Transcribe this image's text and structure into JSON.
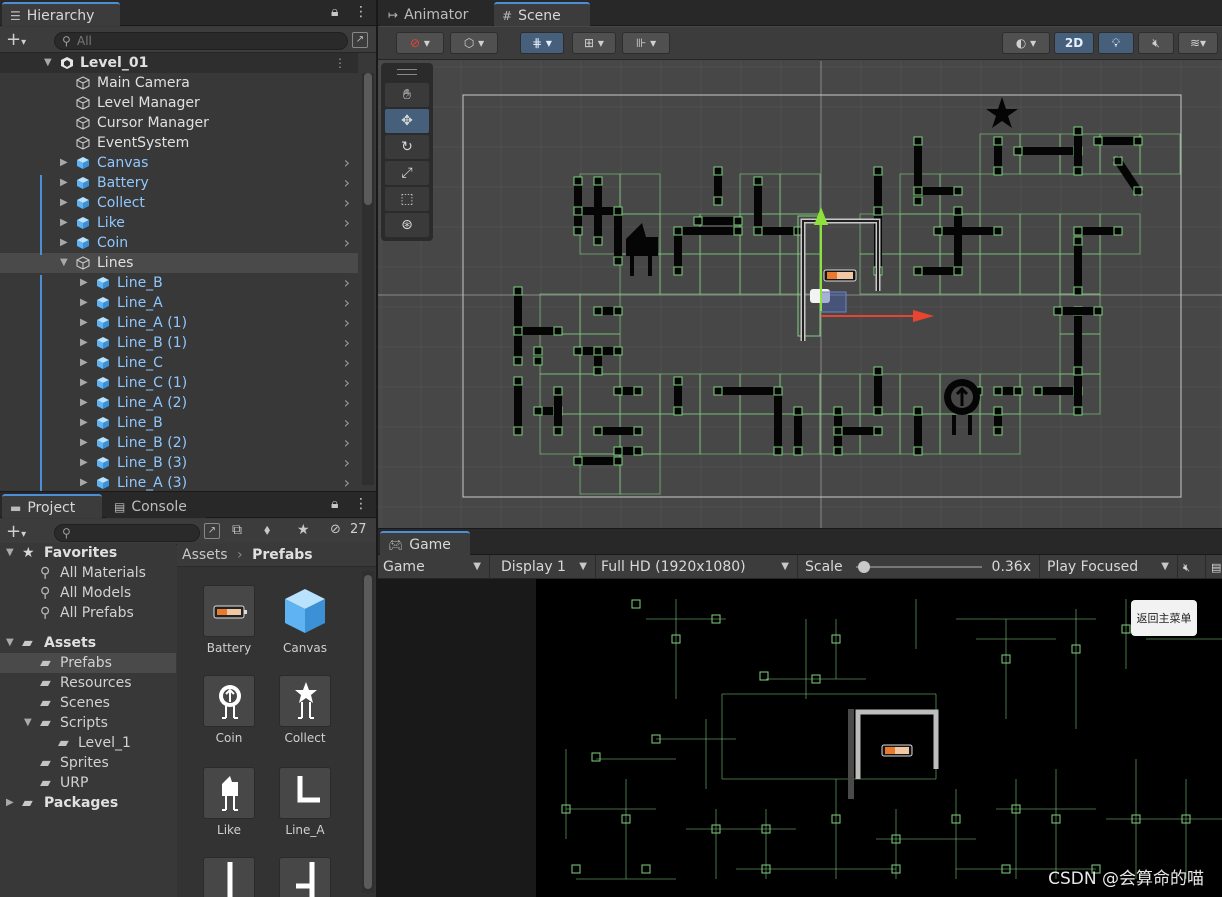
{
  "hierarchy": {
    "tab_label": "Hierarchy",
    "search_placeholder": "All",
    "scene_name": "Level_01",
    "items": [
      {
        "label": "Main Camera",
        "kind": "plain",
        "indent": 1,
        "expandable": false
      },
      {
        "label": "Level Manager",
        "kind": "plain",
        "indent": 1,
        "expandable": false
      },
      {
        "label": "Cursor Manager",
        "kind": "plain",
        "indent": 1,
        "expandable": false
      },
      {
        "label": "EventSystem",
        "kind": "plain",
        "indent": 1,
        "expandable": false
      },
      {
        "label": "Canvas",
        "kind": "prefab",
        "indent": 1,
        "expandable": true
      },
      {
        "label": "Battery",
        "kind": "prefab",
        "indent": 1,
        "expandable": true
      },
      {
        "label": "Collect",
        "kind": "prefab",
        "indent": 1,
        "expandable": true
      },
      {
        "label": "Like",
        "kind": "prefab",
        "indent": 1,
        "expandable": true
      },
      {
        "label": "Coin",
        "kind": "prefab",
        "indent": 1,
        "expandable": true
      },
      {
        "label": "Lines",
        "kind": "plain",
        "indent": 1,
        "expandable": true,
        "expanded": true,
        "selected": true
      },
      {
        "label": "Line_B",
        "kind": "prefab",
        "indent": 2,
        "expandable": true
      },
      {
        "label": "Line_A",
        "kind": "prefab",
        "indent": 2,
        "expandable": true
      },
      {
        "label": "Line_A (1)",
        "kind": "prefab",
        "indent": 2,
        "expandable": true
      },
      {
        "label": "Line_B (1)",
        "kind": "prefab",
        "indent": 2,
        "expandable": true
      },
      {
        "label": "Line_C",
        "kind": "prefab",
        "indent": 2,
        "expandable": true
      },
      {
        "label": "Line_C (1)",
        "kind": "prefab",
        "indent": 2,
        "expandable": true
      },
      {
        "label": "Line_A (2)",
        "kind": "prefab",
        "indent": 2,
        "expandable": true
      },
      {
        "label": "Line_B",
        "kind": "prefab",
        "indent": 2,
        "expandable": true
      },
      {
        "label": "Line_B (2)",
        "kind": "prefab",
        "indent": 2,
        "expandable": true
      },
      {
        "label": "Line_B (3)",
        "kind": "prefab",
        "indent": 2,
        "expandable": true
      },
      {
        "label": "Line_A (3)",
        "kind": "prefab",
        "indent": 2,
        "expandable": true
      }
    ]
  },
  "project": {
    "tab_label": "Project",
    "console_label": "Console",
    "hidden_count": "27",
    "favorites_label": "Favorites",
    "favorites": [
      "All Materials",
      "All Models",
      "All Prefabs"
    ],
    "assets_label": "Assets",
    "folders": [
      {
        "label": "Prefabs",
        "depth": 1,
        "selected": true
      },
      {
        "label": "Resources",
        "depth": 1
      },
      {
        "label": "Scenes",
        "depth": 1
      },
      {
        "label": "Scripts",
        "depth": 1,
        "expanded": true
      },
      {
        "label": "Level_1",
        "depth": 2
      },
      {
        "label": "Sprites",
        "depth": 1
      },
      {
        "label": "URP",
        "depth": 1
      }
    ],
    "packages_label": "Packages",
    "breadcrumb": {
      "root": "Assets",
      "current": "Prefabs"
    },
    "assets": [
      {
        "label": "Battery",
        "icon": "battery-icon"
      },
      {
        "label": "Canvas",
        "icon": "cube-icon"
      },
      {
        "label": "Coin",
        "icon": "coin-icon"
      },
      {
        "label": "Collect",
        "icon": "collect-icon"
      },
      {
        "label": "Like",
        "icon": "like-icon"
      },
      {
        "label": "Line_A",
        "icon": "line-a-icon"
      },
      {
        "label": "",
        "icon": "line-b-icon"
      },
      {
        "label": "",
        "icon": "line-c-icon"
      }
    ]
  },
  "scene_view": {
    "animator_tab": "Animator",
    "scene_tab": "Scene",
    "mode_2d": "2D"
  },
  "game_view": {
    "tab_label": "Game",
    "view_dropdown": "Game",
    "display": "Display 1",
    "resolution": "Full HD (1920x1080)",
    "scale_label": "Scale",
    "scale_value": "0.36x",
    "scale_fraction": 0.06,
    "play_mode": "Play Focused",
    "return_button": "返回主菜单",
    "watermark": "CSDN @会算命的喵"
  },
  "colors": {
    "accent": "#4c8fd6",
    "prefab_text": "#8fc8ff",
    "collider_green": "#7fd27f",
    "battery_orange": "#e87a2d",
    "gizmo_red": "#e8442f",
    "gizmo_green": "#8ee03a"
  }
}
